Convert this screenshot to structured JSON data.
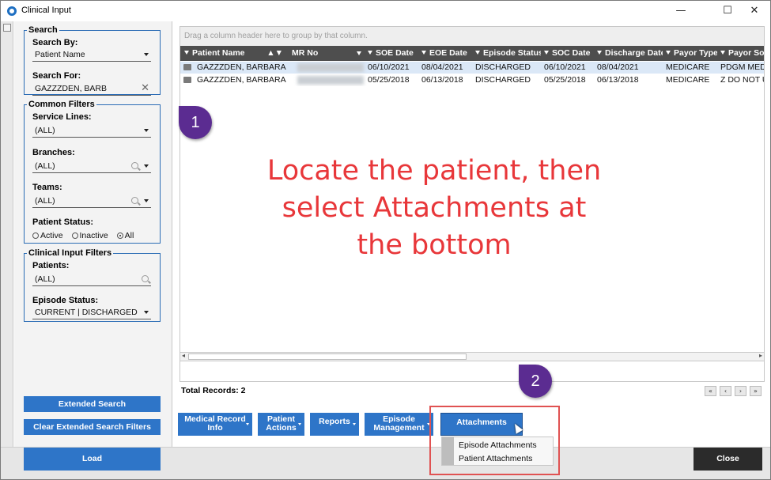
{
  "window": {
    "title": "Clinical Input",
    "controls": [
      "—",
      "☐",
      "✕"
    ]
  },
  "filters": {
    "search": {
      "legend": "Search",
      "search_by_label": "Search By:",
      "search_by_value": "Patient Name",
      "search_for_label": "Search For:",
      "search_for_value": "GAZZZDEN, BARB"
    },
    "common": {
      "legend": "Common Filters",
      "service_lines_label": "Service Lines:",
      "service_lines_value": "(ALL)",
      "branches_label": "Branches:",
      "branches_value": "(ALL)",
      "teams_label": "Teams:",
      "teams_value": "(ALL)",
      "patient_status_label": "Patient Status:",
      "status_options": [
        "Active",
        "Inactive",
        "All"
      ],
      "status_selected": "All"
    },
    "clinical": {
      "legend": "Clinical Input Filters",
      "patients_label": "Patients:",
      "patients_value": "(ALL)",
      "episode_status_label": "Episode Status:",
      "episode_status_value": "CURRENT | DISCHARGED"
    },
    "extended_search_label": "Extended Search",
    "clear_extended_label": "Clear Extended Search Filters",
    "load_label": "Load"
  },
  "grid": {
    "group_hint": "Drag a column header here to group by that column.",
    "columns": [
      "Patient Name",
      "MR No",
      "SOE Date",
      "EOE Date",
      "Episode Status",
      "SOC Date",
      "Discharge Date",
      "Payor Type",
      "Payor Source"
    ],
    "rows": [
      {
        "name": "GAZZZDEN, BARBARA J.",
        "soe": "06/10/2021",
        "eoe": "08/04/2021",
        "status": "DISCHARGED",
        "soc": "06/10/2021",
        "discharge": "08/04/2021",
        "payor_type": "MEDICARE",
        "payor_source": "PDGM MEDICARE"
      },
      {
        "name": "GAZZZDEN, BARBARA J.",
        "soe": "05/25/2018",
        "eoe": "06/13/2018",
        "status": "DISCHARGED",
        "soc": "05/25/2018",
        "discharge": "06/13/2018",
        "payor_type": "MEDICARE",
        "payor_source": "Z DO NOT USE"
      }
    ],
    "total_records": "Total Records: 2"
  },
  "pager": [
    "«",
    "‹",
    "›",
    "»"
  ],
  "actions": {
    "medical_record": [
      "Medical Record",
      "Info"
    ],
    "patient_actions": [
      "Patient",
      "Actions"
    ],
    "reports": "Reports",
    "episode_management": [
      "Episode",
      "Management"
    ],
    "attachments": "Attachments"
  },
  "attachments_menu": [
    "Episode Attachments",
    "Patient Attachments"
  ],
  "close_label": "Close",
  "annotations": {
    "step1": "1",
    "step2": "2",
    "instruction_lines": [
      "Locate the patient, then",
      "select Attachments at",
      "the bottom"
    ],
    "pin_color": "#5b2c91",
    "text_color": "#e8373a"
  }
}
